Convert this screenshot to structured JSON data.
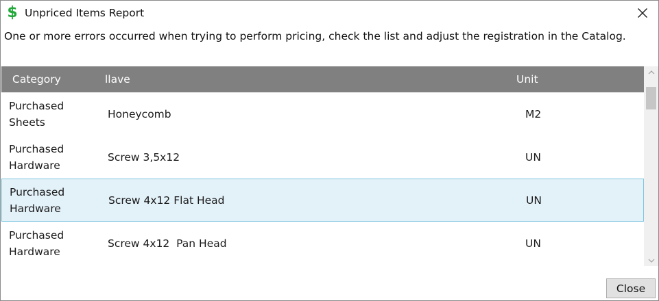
{
  "window": {
    "title": "Unpriced Items Report",
    "icon": "dollar-icon",
    "accent_color": "#22a83a"
  },
  "message": "One or more errors occurred when trying to perform pricing, check the list and adjust the registration in the Catalog.",
  "grid": {
    "columns": [
      "Category",
      "llave",
      "Unit"
    ],
    "header_color": "#808080",
    "selected_row_color": "#e3f1f9",
    "rows": [
      {
        "category": "Purchased\nSheets",
        "key": "Honeycomb",
        "unit": "M2"
      },
      {
        "category": "Purchased\nHardware",
        "key": "Screw 3,5x12",
        "unit": "UN"
      },
      {
        "category": "Purchased\nHardware",
        "key": "Screw 4x12 Flat Head",
        "unit": "UN",
        "selected": true
      },
      {
        "category": "Purchased\nHardware",
        "key": "Screw 4x12  Pan Head",
        "unit": "UN"
      }
    ]
  },
  "buttons": {
    "close": "Close"
  }
}
